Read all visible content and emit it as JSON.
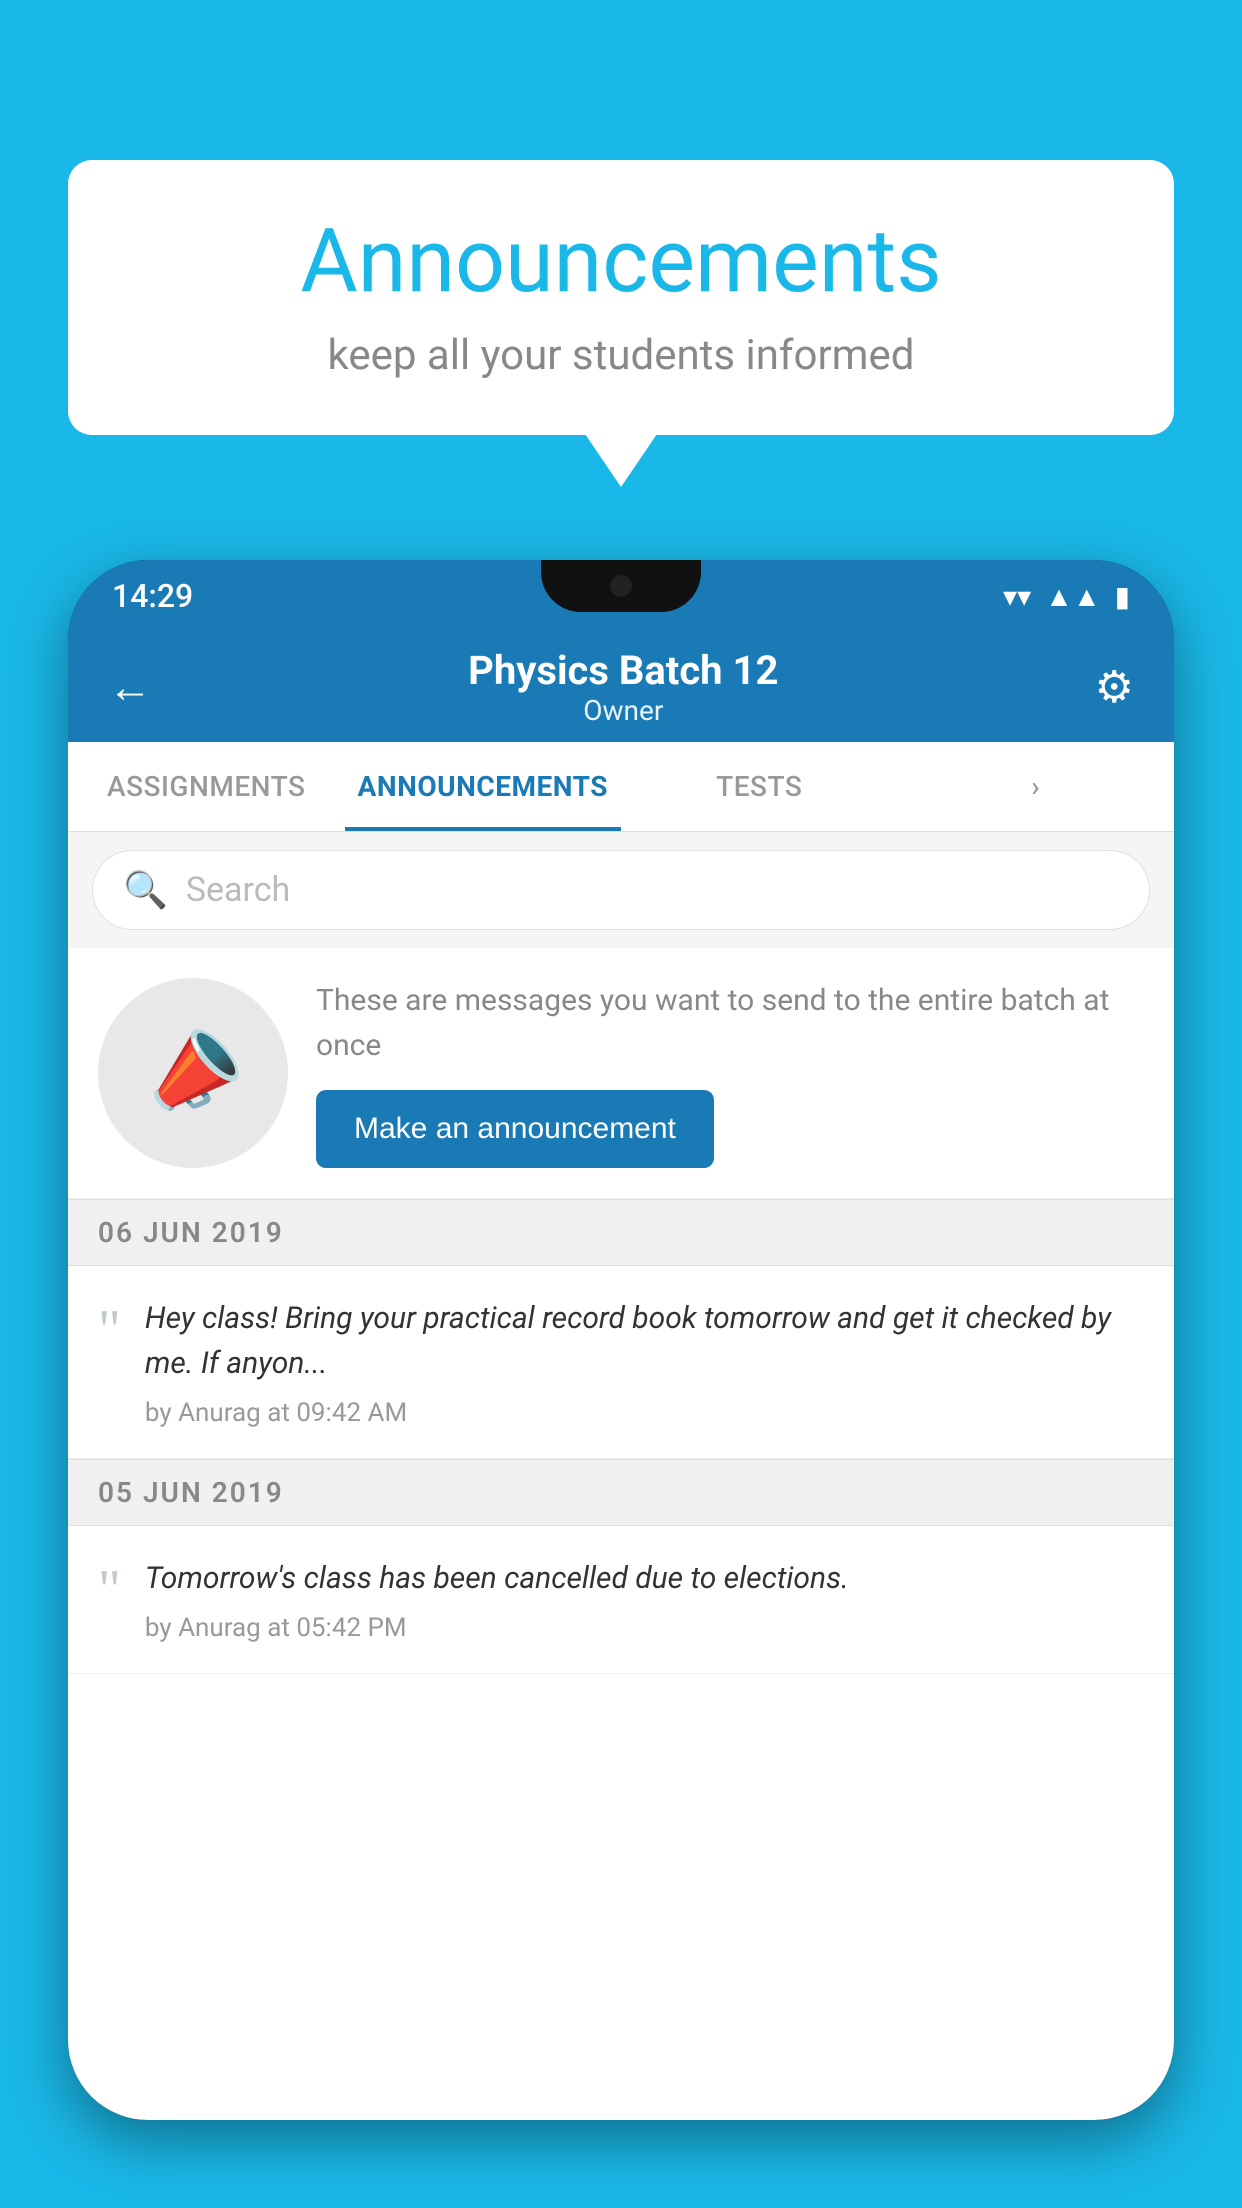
{
  "background_color": "#1ab8e8",
  "speech_bubble": {
    "title": "Announcements",
    "subtitle": "keep all your students informed"
  },
  "phone": {
    "status_bar": {
      "time": "14:29",
      "icons": [
        "wifi",
        "signal",
        "battery"
      ]
    },
    "header": {
      "back_label": "←",
      "title": "Physics Batch 12",
      "subtitle": "Owner",
      "gear_label": "⚙"
    },
    "tabs": [
      {
        "label": "ASSIGNMENTS",
        "active": false
      },
      {
        "label": "ANNOUNCEMENTS",
        "active": true
      },
      {
        "label": "TESTS",
        "active": false
      },
      {
        "label": "",
        "active": false
      }
    ],
    "search": {
      "placeholder": "Search"
    },
    "promo": {
      "text": "These are messages you want to send to the entire batch at once",
      "button_label": "Make an announcement"
    },
    "announcements": [
      {
        "date": "06  JUN  2019",
        "text": "Hey class! Bring your practical record book tomorrow and get it checked by me. If anyon...",
        "meta": "by Anurag at 09:42 AM"
      },
      {
        "date": "05  JUN  2019",
        "text": "Tomorrow's class has been cancelled due to elections.",
        "meta": "by Anurag at 05:42 PM"
      }
    ]
  }
}
